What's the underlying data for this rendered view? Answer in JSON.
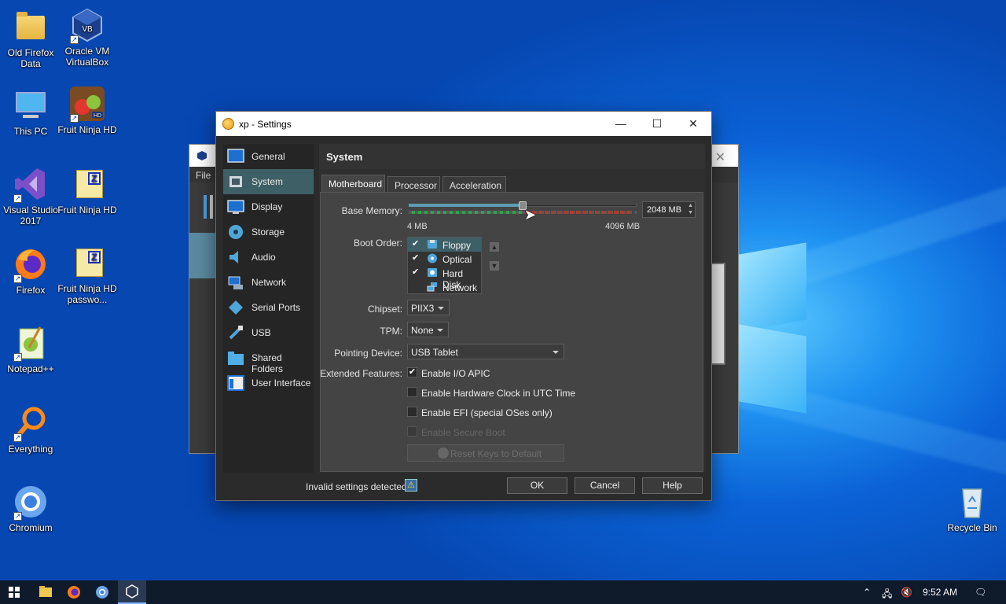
{
  "desktop": {
    "icons": [
      {
        "label": "Old Firefox Data",
        "icon": "folder-icon"
      },
      {
        "label": "Oracle VM VirtualBox",
        "icon": "virtualbox-icon"
      },
      {
        "label": "This PC",
        "icon": "computer-icon"
      },
      {
        "label": "Fruit Ninja HD",
        "icon": "fruit-ninja-icon"
      },
      {
        "label": "Visual Studio 2017",
        "icon": "visual-studio-icon"
      },
      {
        "label": "Fruit Ninja HD",
        "icon": "zip-archive-icon"
      },
      {
        "label": "Firefox",
        "icon": "firefox-icon"
      },
      {
        "label": "Fruit Ninja HD passwo...",
        "icon": "zip-archive-icon"
      },
      {
        "label": "Notepad++",
        "icon": "notepadpp-icon"
      },
      {
        "label": "Everything",
        "icon": "everything-search-icon"
      },
      {
        "label": "Chromium",
        "icon": "chromium-icon"
      },
      {
        "label": "Recycle Bin",
        "icon": "recycle-bin-icon"
      }
    ]
  },
  "backwin": {
    "menu_file": "File"
  },
  "settings": {
    "title": "xp - Settings",
    "nav": [
      {
        "label": "General",
        "icon": "general-icon"
      },
      {
        "label": "System",
        "icon": "system-chip-icon",
        "selected": true
      },
      {
        "label": "Display",
        "icon": "display-icon"
      },
      {
        "label": "Storage",
        "icon": "storage-icon"
      },
      {
        "label": "Audio",
        "icon": "audio-icon"
      },
      {
        "label": "Network",
        "icon": "network-icon"
      },
      {
        "label": "Serial Ports",
        "icon": "serial-port-icon"
      },
      {
        "label": "USB",
        "icon": "usb-icon"
      },
      {
        "label": "Shared Folders",
        "icon": "shared-folder-icon"
      },
      {
        "label": "User Interface",
        "icon": "user-interface-icon"
      }
    ],
    "page_title": "System",
    "tabs": [
      {
        "label": "Motherboard",
        "selected": true
      },
      {
        "label": "Processor"
      },
      {
        "label": "Acceleration"
      }
    ],
    "base_memory": {
      "label": "Base Memory:",
      "value": "2048 MB",
      "fraction": 0.5,
      "min_label": "4 MB",
      "max_label": "4096 MB"
    },
    "boot_order": {
      "label": "Boot Order:",
      "items": [
        {
          "label": "Floppy",
          "checked": true,
          "icon": "floppy-icon"
        },
        {
          "label": "Optical",
          "checked": true,
          "icon": "optical-disc-icon"
        },
        {
          "label": "Hard Disk",
          "checked": true,
          "icon": "hard-disk-icon"
        },
        {
          "label": "Network",
          "checked": false,
          "icon": "network-boot-icon"
        }
      ]
    },
    "chipset": {
      "label": "Chipset:",
      "value": "PIIX3"
    },
    "tpm": {
      "label": "TPM:",
      "value": "None"
    },
    "pointing": {
      "label": "Pointing Device:",
      "value": "USB Tablet"
    },
    "extended": {
      "label": "Extended Features:",
      "io_apic": {
        "label": "Enable I/O APIC",
        "checked": true
      },
      "utc": {
        "label": "Enable Hardware Clock in UTC Time",
        "checked": false
      },
      "efi": {
        "label": "Enable EFI (special OSes only)",
        "checked": false
      },
      "secure_boot": {
        "label": "Enable Secure Boot",
        "checked": false,
        "disabled": true
      }
    },
    "reset_keys": "Reset Keys to Default",
    "invalid": "Invalid settings detected",
    "ok": "OK",
    "cancel": "Cancel",
    "help": "Help"
  },
  "taskbar": {
    "time": "9:52 AM"
  }
}
